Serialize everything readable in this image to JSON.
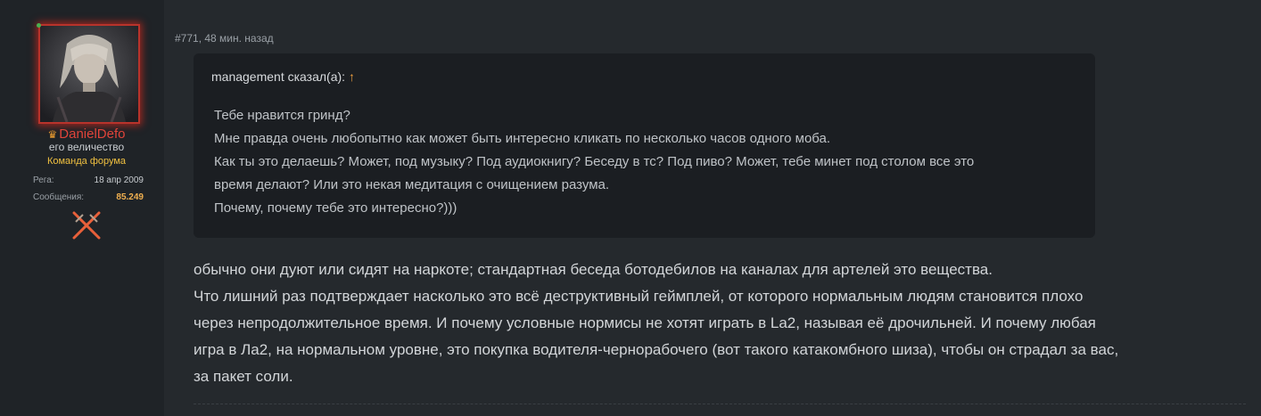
{
  "author": {
    "username": "DanielDefo",
    "title": "его величество",
    "team": "Команда форума",
    "stats": [
      {
        "label": "Рега:",
        "value": "18 апр 2009"
      },
      {
        "label": "Сообщения:",
        "value": "85.249"
      }
    ]
  },
  "post": {
    "meta": "#771, 48 мин. назад",
    "quote": {
      "author": "management сказал(а):",
      "arrow": "↑",
      "lines": [
        "Тебе нравится гринд?",
        "Мне правда очень любопытно как может быть интересно кликать по несколько часов одного моба.",
        "Как ты это делаешь? Может, под музыку? Под аудиокнигу? Беседу в тс? Под пиво? Может, тебе минет под столом все это",
        "время делают? Или это некая медитация с очищением разума.",
        "Почему, почему тебе это интересно?)))"
      ]
    },
    "body": [
      "обычно они дуют или сидят на наркоте; стандартная беседа ботодебилов на каналах для артелей это вещества.",
      "Что лишний раз подтверждает насколько это всё деструктивный геймплей, от которого нормальным людям становится плохо",
      "через непродолжительное время. И почему условные нормисы не хотят играть в La2, называя её дрочильней. И почему любая",
      "игра в Ла2, на нормальном уровне, это покупка водителя-чернорабочего (вот такого катакомбного шиза), чтобы он страдал за вас,",
      "за пакет соли."
    ]
  },
  "icons": [
    "crown-icon",
    "crossed-swords-icon",
    "online-status-icon"
  ],
  "colors": {
    "username": "#e0443a",
    "team_badge": "#f0c040",
    "message_count": "#f0b050",
    "avatar_glow": "#b8332b"
  }
}
